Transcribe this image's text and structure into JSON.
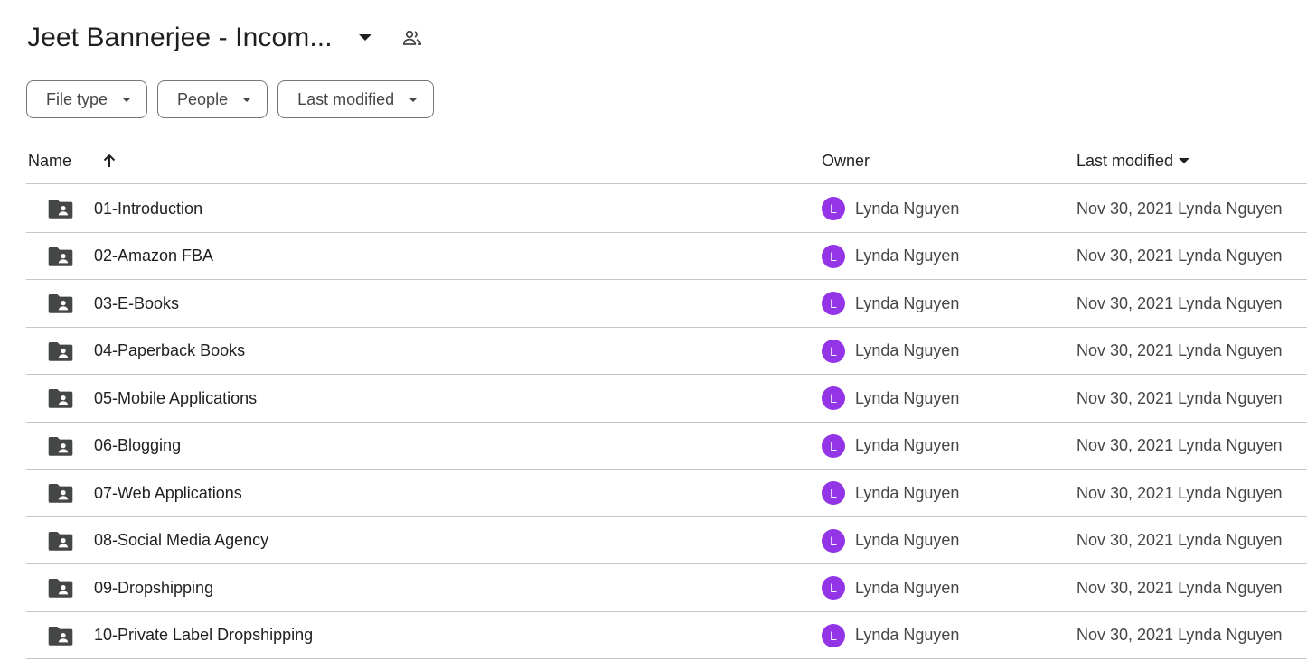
{
  "header": {
    "title": "Jeet Bannerjee - Incom...",
    "title_dropdown_icon": "caret-down-icon",
    "shared_icon": "people-icon"
  },
  "filters": [
    {
      "label": "File type"
    },
    {
      "label": "People"
    },
    {
      "label": "Last modified"
    }
  ],
  "table": {
    "columns": {
      "name": "Name",
      "owner": "Owner",
      "last_modified": "Last modified"
    },
    "sort_icon": "arrow-up-icon",
    "rows": [
      {
        "name": "01-Introduction",
        "owner_initial": "L",
        "owner": "Lynda Nguyen",
        "modified": "Nov 30, 2021 Lynda Nguyen"
      },
      {
        "name": "02-Amazon FBA",
        "owner_initial": "L",
        "owner": "Lynda Nguyen",
        "modified": "Nov 30, 2021 Lynda Nguyen"
      },
      {
        "name": "03-E-Books",
        "owner_initial": "L",
        "owner": "Lynda Nguyen",
        "modified": "Nov 30, 2021 Lynda Nguyen"
      },
      {
        "name": "04-Paperback Books",
        "owner_initial": "L",
        "owner": "Lynda Nguyen",
        "modified": "Nov 30, 2021 Lynda Nguyen"
      },
      {
        "name": "05-Mobile Applications",
        "owner_initial": "L",
        "owner": "Lynda Nguyen",
        "modified": "Nov 30, 2021 Lynda Nguyen"
      },
      {
        "name": "06-Blogging",
        "owner_initial": "L",
        "owner": "Lynda Nguyen",
        "modified": "Nov 30, 2021 Lynda Nguyen"
      },
      {
        "name": "07-Web Applications",
        "owner_initial": "L",
        "owner": "Lynda Nguyen",
        "modified": "Nov 30, 2021 Lynda Nguyen"
      },
      {
        "name": "08-Social Media Agency",
        "owner_initial": "L",
        "owner": "Lynda Nguyen",
        "modified": "Nov 30, 2021 Lynda Nguyen"
      },
      {
        "name": "09-Dropshipping",
        "owner_initial": "L",
        "owner": "Lynda Nguyen",
        "modified": "Nov 30, 2021 Lynda Nguyen"
      },
      {
        "name": "10-Private Label Dropshipping",
        "owner_initial": "L",
        "owner": "Lynda Nguyen",
        "modified": "Nov 30, 2021 Lynda Nguyen"
      }
    ]
  },
  "colors": {
    "avatar": "#9334e6",
    "text": "#1f1f1f",
    "secondary_text": "#444746",
    "divider": "#c4c7c5",
    "folder_icon": "#444746"
  }
}
